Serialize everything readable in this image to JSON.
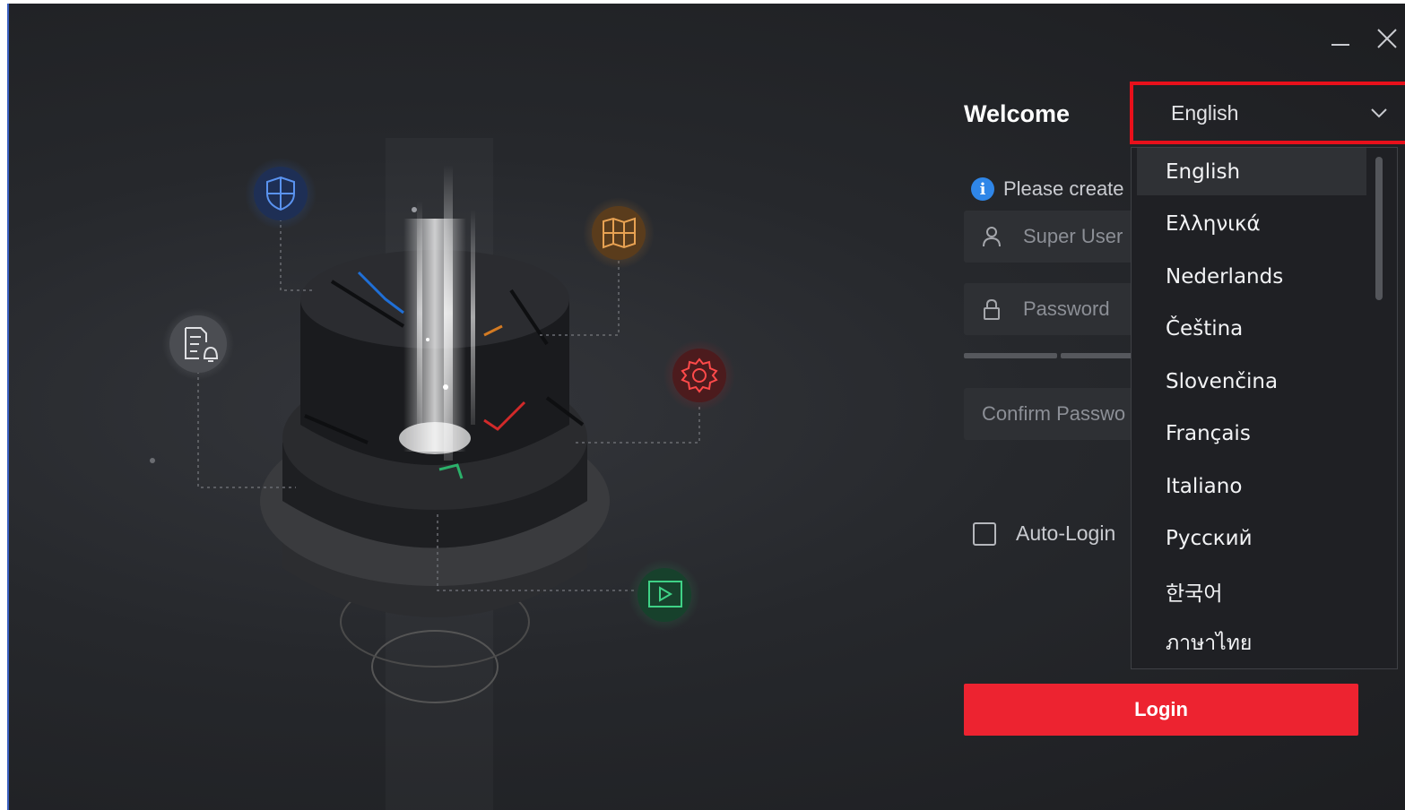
{
  "window": {
    "minimize_icon": "minimize-icon",
    "close_icon": "close-icon"
  },
  "illustration": {
    "icons": [
      "shield-icon",
      "map-icon",
      "document-bell-icon",
      "gear-icon",
      "video-icon"
    ]
  },
  "login_panel": {
    "title": "Welcome",
    "notice": "Please create",
    "username_placeholder": "Super User",
    "password_placeholder": "Password",
    "confirm_placeholder": "Confirm Password",
    "auto_login_label": "Auto-Login",
    "login_button": "Login"
  },
  "language": {
    "selected": "English",
    "options": [
      "English",
      "Ελληνικά",
      "Nederlands",
      "Čeština",
      "Slovenčina",
      "Français",
      "Italiano",
      "Русский",
      "한국어",
      "ภาษาไทย"
    ]
  },
  "colors": {
    "accent_red": "#ed2330",
    "highlight_box": "#e8101b",
    "info_blue": "#2f86e8",
    "background": "#26282c"
  }
}
